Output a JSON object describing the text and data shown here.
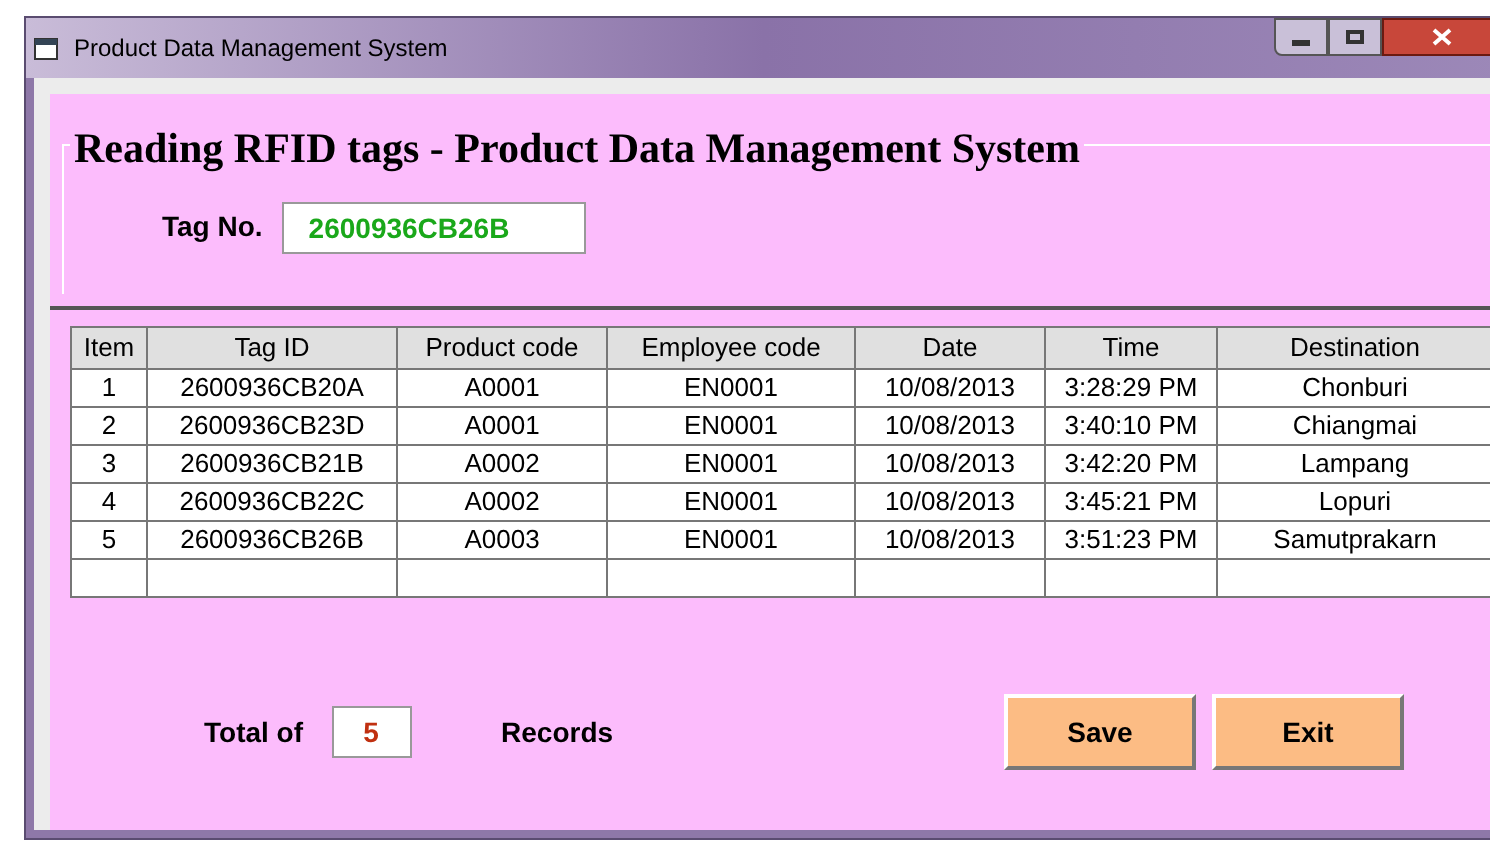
{
  "window": {
    "title": "Product Data Management System"
  },
  "heading": "Reading RFID tags - Product Data Management System",
  "tag_field": {
    "label": "Tag No.",
    "value": "2600936CB26B"
  },
  "table": {
    "columns": [
      "Item",
      "Tag ID",
      "Product code",
      "Employee code",
      "Date",
      "Time",
      "Destination"
    ],
    "rows": [
      [
        "1",
        "2600936CB20A",
        "A0001",
        "EN0001",
        "10/08/2013",
        "3:28:29 PM",
        "Chonburi"
      ],
      [
        "2",
        "2600936CB23D",
        "A0001",
        "EN0001",
        "10/08/2013",
        "3:40:10 PM",
        "Chiangmai"
      ],
      [
        "3",
        "2600936CB21B",
        "A0002",
        "EN0001",
        "10/08/2013",
        "3:42:20 PM",
        "Lampang"
      ],
      [
        "4",
        "2600936CB22C",
        "A0002",
        "EN0001",
        "10/08/2013",
        "3:45:21 PM",
        "Lopuri"
      ],
      [
        "5",
        "2600936CB26B",
        "A0003",
        "EN0001",
        "10/08/2013",
        "3:51:23 PM",
        "Samutprakarn"
      ]
    ]
  },
  "total": {
    "prefix": "Total of",
    "value": "5",
    "suffix": "Records"
  },
  "buttons": [
    "Save",
    "Exit"
  ]
}
